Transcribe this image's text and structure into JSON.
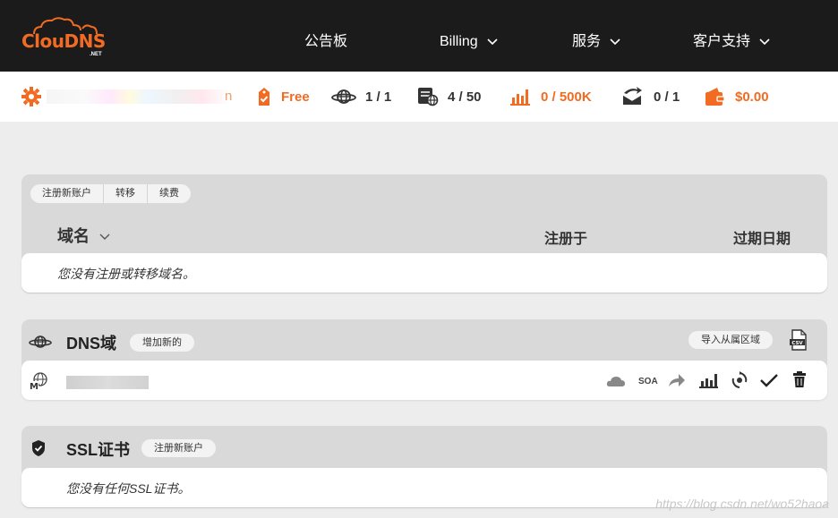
{
  "brand": {
    "logo_text": "ClouDNS",
    "logo_sub": ".NET"
  },
  "nav": [
    {
      "label": "公告板",
      "dropdown": false
    },
    {
      "label": "Billing",
      "dropdown": true
    },
    {
      "label": "服务",
      "dropdown": true
    },
    {
      "label": "客户支持",
      "dropdown": true
    }
  ],
  "status": {
    "account_suffix": "n",
    "plan": "Free",
    "dns_zones": "1 / 1",
    "records": "4 / 50",
    "queries": "0 / 500K",
    "mail_forwards": "0 / 1",
    "balance": "$0.00"
  },
  "domains_panel": {
    "actions": [
      "注册新账户",
      "转移",
      "续费"
    ],
    "col_domain": "域名",
    "col_registered": "注册于",
    "col_expiry": "过期日期",
    "empty_message": "您没有注册或转移域名。"
  },
  "dns_panel": {
    "title": "DNS域",
    "add_button": "增加新的",
    "import_button": "导入从属区域",
    "row_actions": [
      "cloud",
      "SOA",
      "share",
      "stats",
      "sync",
      "check",
      "delete"
    ],
    "soa_label": "SOA"
  },
  "ssl_panel": {
    "title": "SSL证书",
    "register_button": "注册新账户",
    "empty_message": "您没有任何SSL证书。"
  },
  "watermark": "https://blog.csdn.net/wo52haoa",
  "colors": {
    "accent": "#f26b22",
    "nav_bg": "#1b1b1b",
    "panel_bg": "#d9d9d9",
    "page_bg": "#ededed"
  }
}
